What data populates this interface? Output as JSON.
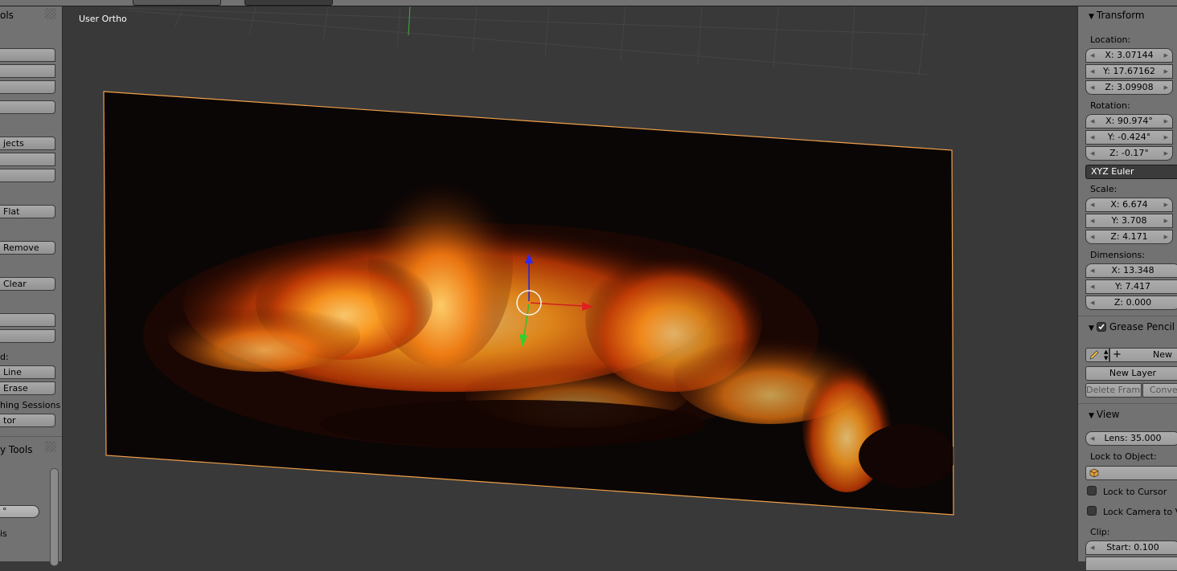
{
  "viewport": {
    "view_label": "User Ortho"
  },
  "left_toolbar": {
    "header_top": "ols",
    "buttons": {
      "objects": "jects",
      "flat": "Flat",
      "remove": "Remove",
      "clear": "Clear",
      "line": "Line",
      "erase": "Erase",
      "sessions": "hing Sessions",
      "tor": "tor"
    },
    "label_d": "d:",
    "tools_header": "y Tools",
    "slider_value": "°",
    "label_is": "is"
  },
  "right_panel": {
    "transform": {
      "header": "Transform",
      "location_label": "Location:",
      "location": {
        "x": "X: 3.07144",
        "y": "Y: 17.67162",
        "z": "Z: 3.09908"
      },
      "rotation_label": "Rotation:",
      "rotation": {
        "x": "X: 90.974°",
        "y": "Y: -0.424°",
        "z": "Z: -0.17°"
      },
      "rotation_mode": "XYZ Euler",
      "scale_label": "Scale:",
      "scale": {
        "x": "X: 6.674",
        "y": "Y: 3.708",
        "z": "Z: 4.171"
      },
      "dimensions_label": "Dimensions:",
      "dimensions": {
        "x": "X: 13.348",
        "y": "Y: 7.417",
        "z": "Z: 0.000"
      }
    },
    "grease_pencil": {
      "header": "Grease Pencil",
      "new_label": "New",
      "new_layer": "New Layer",
      "delete_frame": "Delete Frame",
      "convert": "Conve"
    },
    "view": {
      "header": "View",
      "lens": "Lens: 35.000",
      "lock_to_object_label": "Lock to Object:",
      "lock_to_cursor": "Lock to Cursor",
      "lock_camera": "Lock Camera to Vi",
      "clip_label": "Clip:",
      "clip_start": "Start: 0.100"
    }
  },
  "colors": {
    "panel_bg": "#727272",
    "viewport_bg": "#393939",
    "selection_outline": "#ff9a2e"
  }
}
